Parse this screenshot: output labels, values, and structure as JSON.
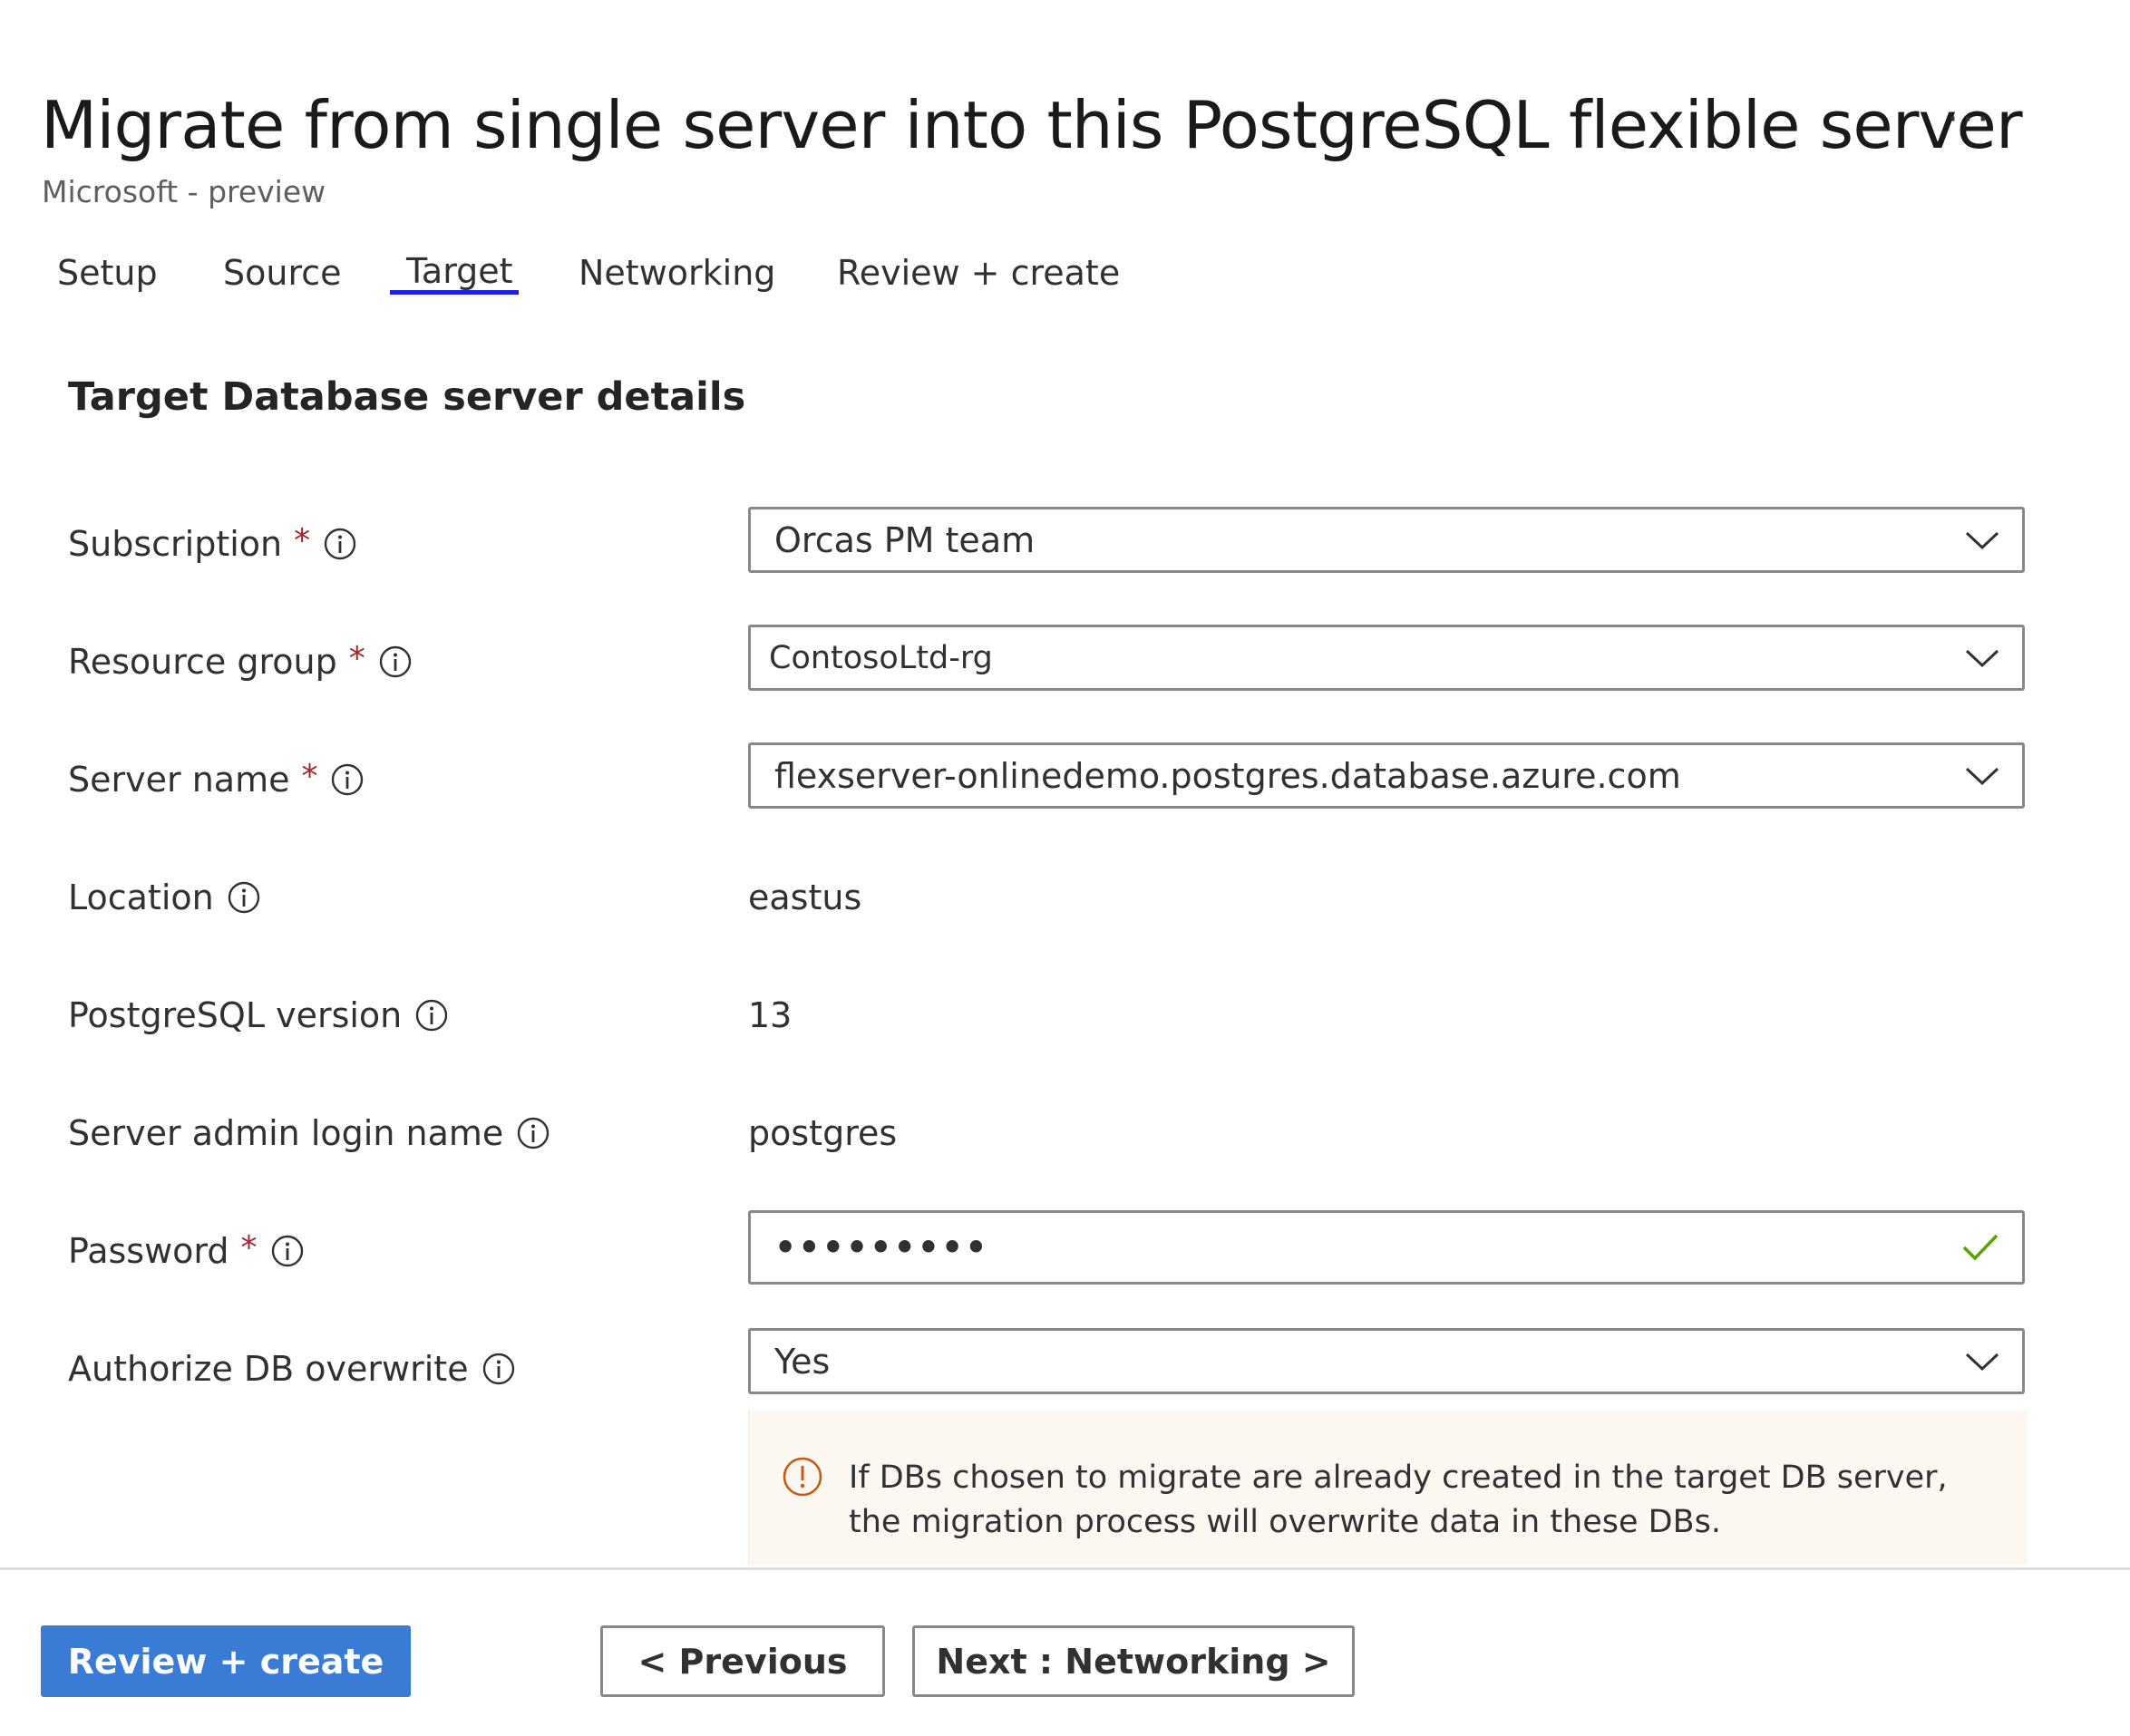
{
  "header": {
    "title": "Migrate from single server into this PostgreSQL flexible server",
    "more_label": "···",
    "subtitle": "Microsoft - preview"
  },
  "tabs": [
    {
      "label": "Setup"
    },
    {
      "label": "Source"
    },
    {
      "label": "Target",
      "active": true
    },
    {
      "label": "Networking"
    },
    {
      "label": "Review + create"
    }
  ],
  "section": {
    "title": "Target Database server details"
  },
  "required_marker": "*",
  "form": {
    "subscription": {
      "label": "Subscription",
      "required": true,
      "value": "Orcas PM team"
    },
    "resource_group": {
      "label": "Resource group",
      "required": true,
      "value": "ContosoLtd-rg"
    },
    "server_name": {
      "label": "Server name",
      "required": true,
      "value": "flexserver-onlinedemo.postgres.database.azure.com"
    },
    "location": {
      "label": "Location",
      "value": "eastus"
    },
    "pg_version": {
      "label": "PostgreSQL version",
      "value": "13"
    },
    "admin_login": {
      "label": "Server admin login name",
      "value": "postgres"
    },
    "password": {
      "label": "Password",
      "required": true,
      "value": "•••••••••",
      "valid": true
    },
    "authorize_overwrite": {
      "label": "Authorize DB overwrite",
      "value": "Yes"
    }
  },
  "warning": {
    "icon": "warning-info-icon",
    "text": "If DBs chosen to migrate are already created in the target DB server, the migration process will overwrite data in these DBs."
  },
  "footer": {
    "review_create": "Review + create",
    "previous": "< Previous",
    "next": "Next : Networking >"
  },
  "colors": {
    "primary": "#3a7bd5",
    "tab_underline": "#1f1fe0",
    "required": "#a4262c",
    "warning_icon": "#c75b12",
    "warning_bg": "#fdf7f1",
    "valid_check": "#57a300"
  }
}
